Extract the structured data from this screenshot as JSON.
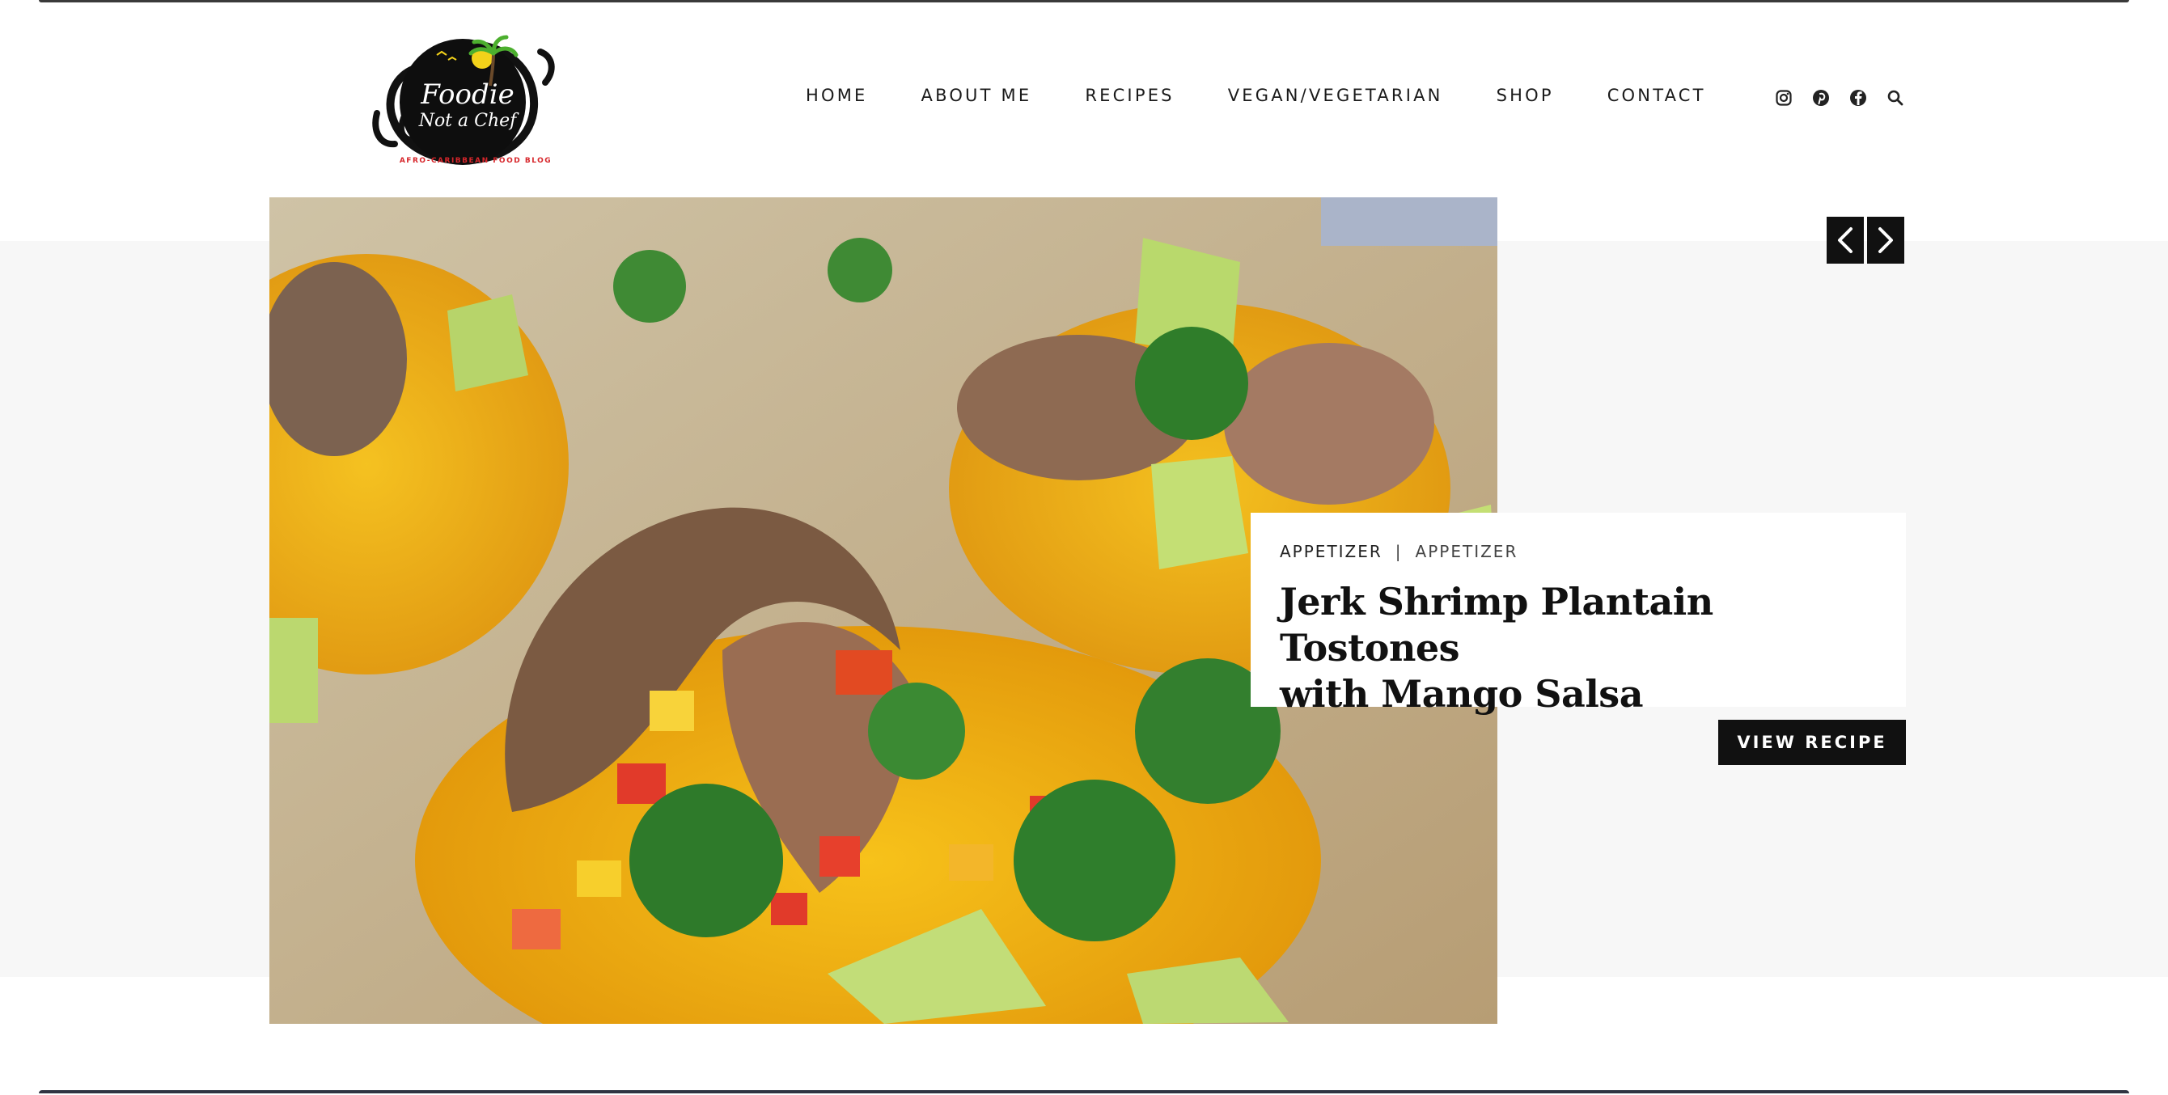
{
  "site": {
    "logo": {
      "line1": "Foodie",
      "line2": "Not a Chef",
      "tagline": "AFRO-CARIBBEAN FOOD BLOG"
    }
  },
  "nav": {
    "items": [
      {
        "label": "HOME"
      },
      {
        "label": "ABOUT ME"
      },
      {
        "label": "RECIPES"
      },
      {
        "label": "VEGAN/VEGETARIAN"
      },
      {
        "label": "SHOP"
      },
      {
        "label": "CONTACT"
      }
    ],
    "social_icons": [
      "instagram-icon",
      "pinterest-icon",
      "facebook-icon",
      "search-icon"
    ]
  },
  "hero": {
    "categories": [
      "APPETIZER",
      "APPETIZER"
    ],
    "separator": "|",
    "title_line1": "Jerk Shrimp Plantain Tostones",
    "title_line2": "with Mango Salsa",
    "button_label": "VIEW RECIPE",
    "arrows": [
      "chevron-left-icon",
      "chevron-right-icon"
    ]
  },
  "colors": {
    "accent": "#111111",
    "band": "#f7f7f7",
    "logo_red": "#d7262b",
    "logo_yellow": "#f3d21a"
  }
}
